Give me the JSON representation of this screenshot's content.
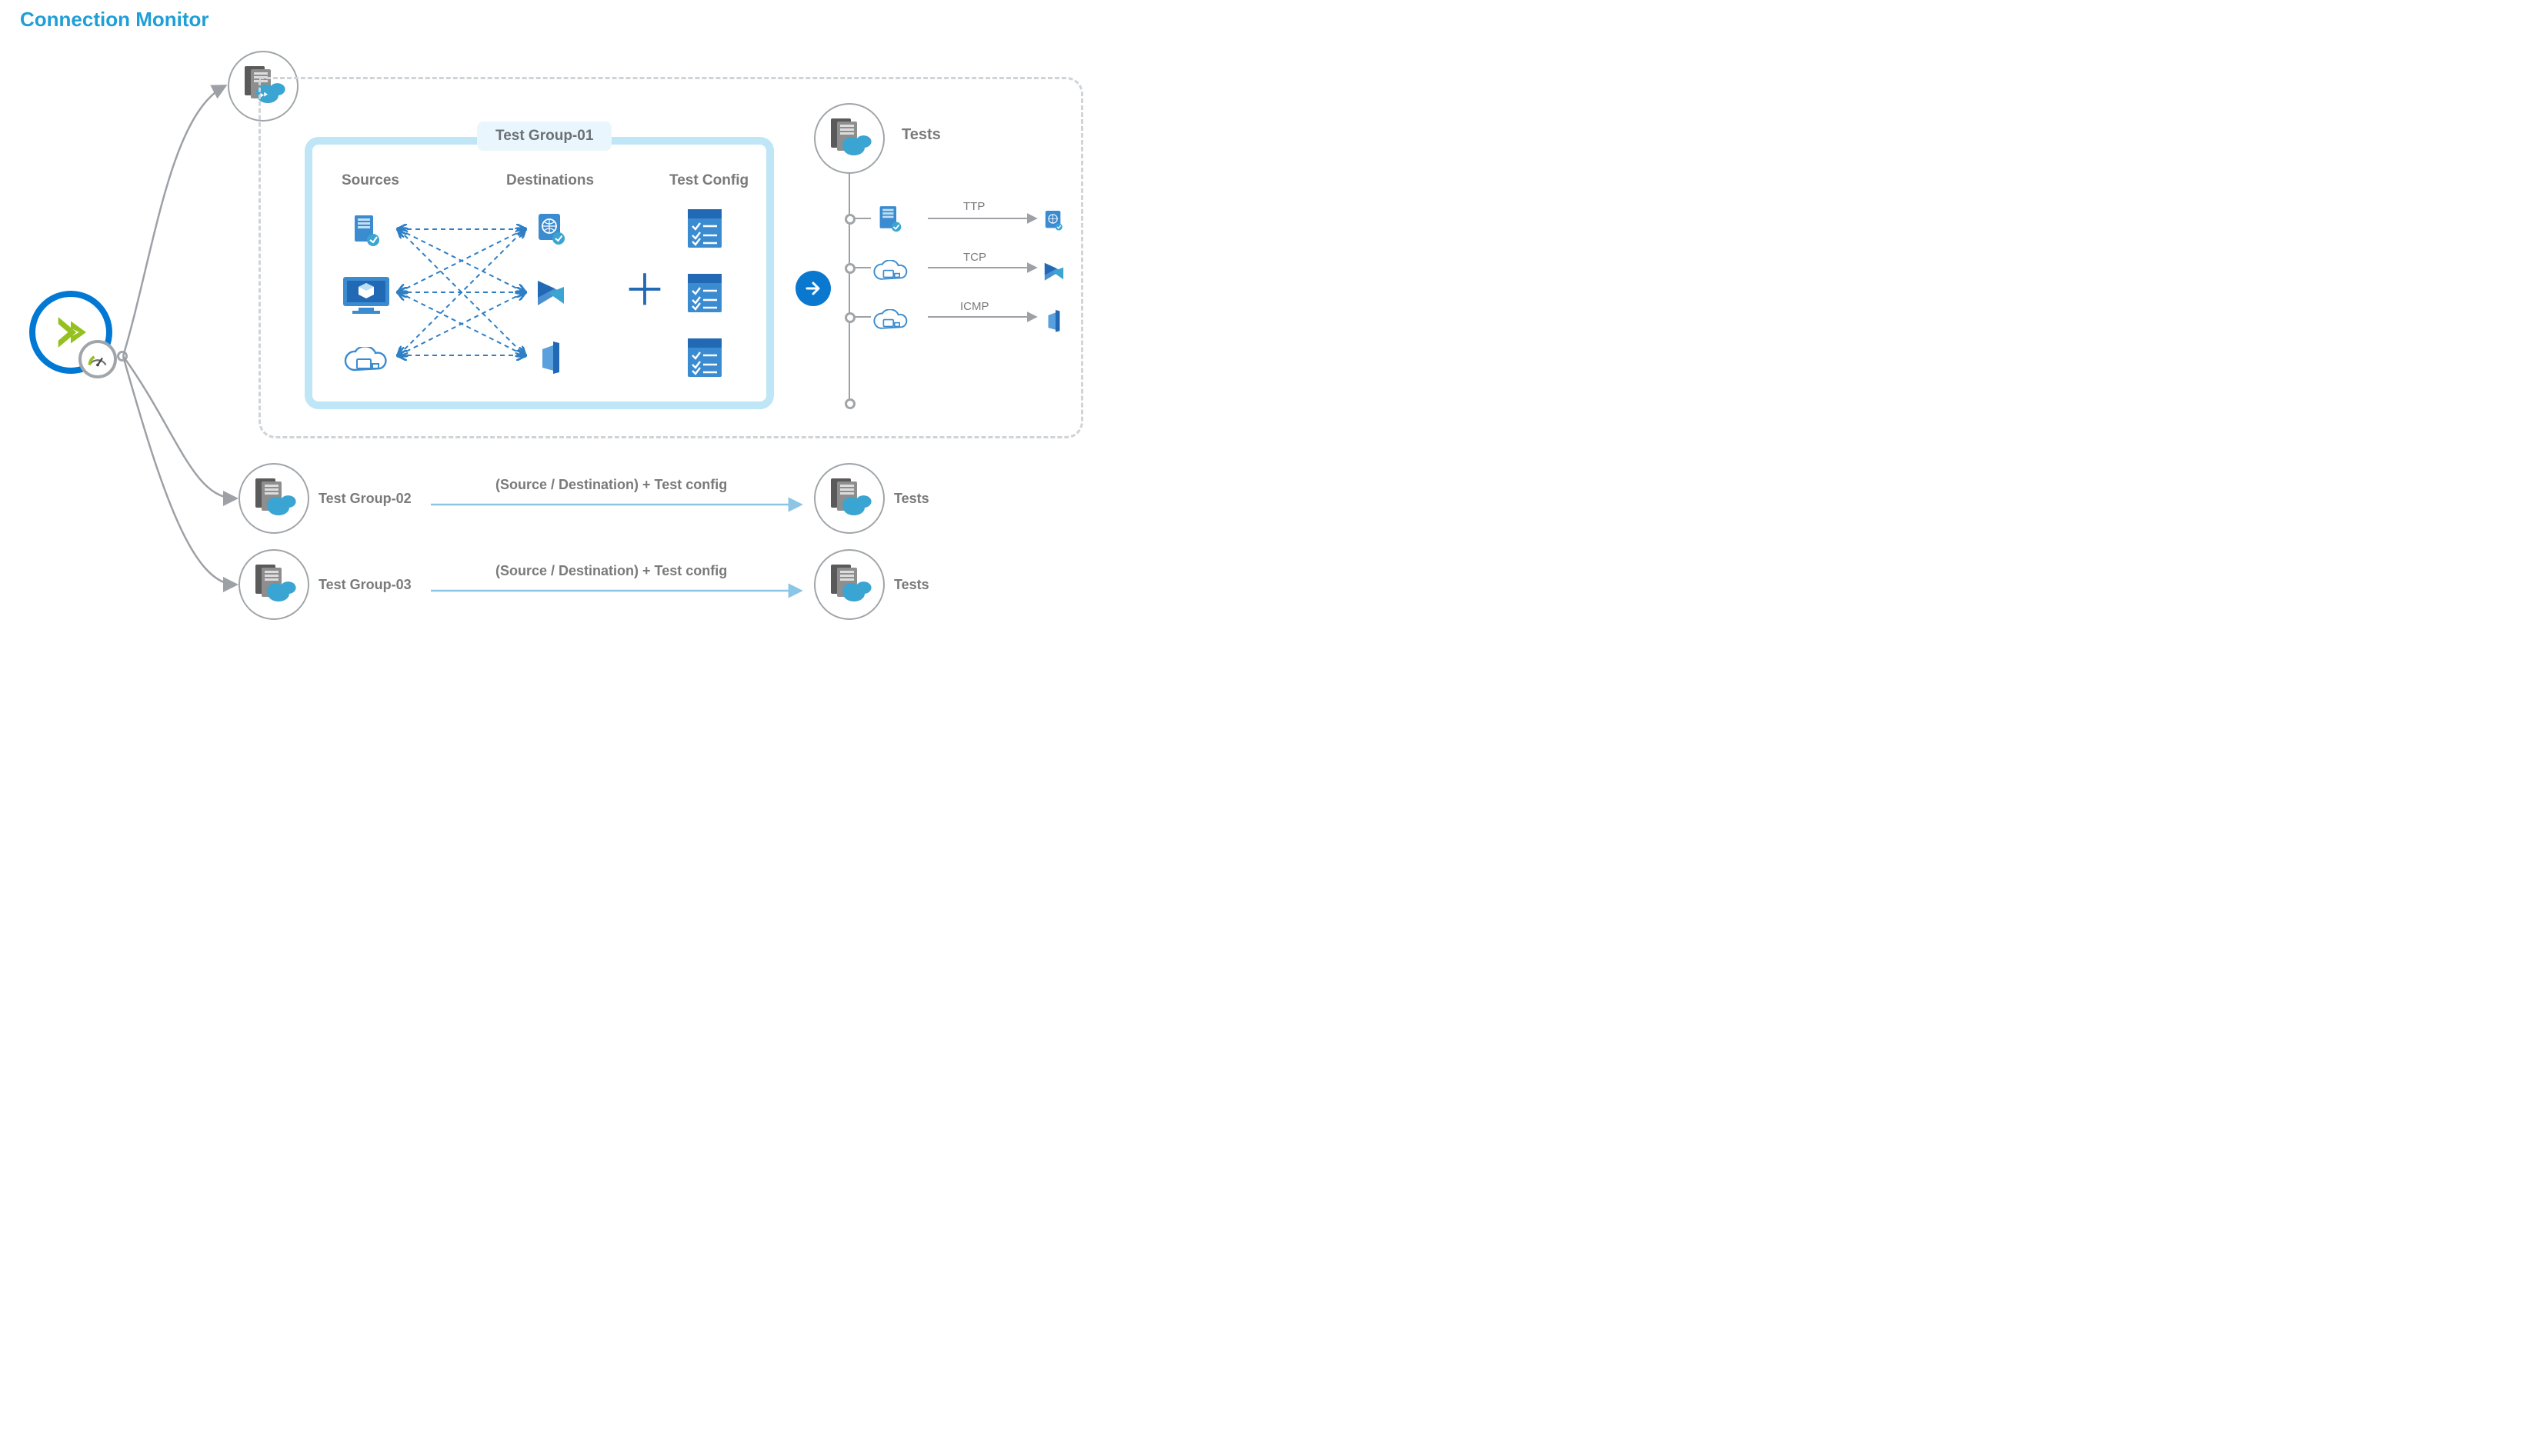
{
  "title": "Connection Monitor",
  "testGroup1": {
    "tab": "Test Group-01",
    "cols": {
      "sources": "Sources",
      "dests": "Destinations",
      "config": "Test Config"
    }
  },
  "testsLabel": "Tests",
  "protocols": [
    "TTP",
    "TCP",
    "ICMP"
  ],
  "row2": {
    "name": "Test Group-02",
    "caption": "(Source / Destination) + Test config",
    "tests": "Tests"
  },
  "row3": {
    "name": "Test Group-03",
    "caption": "(Source / Destination) + Test config",
    "tests": "Tests"
  }
}
